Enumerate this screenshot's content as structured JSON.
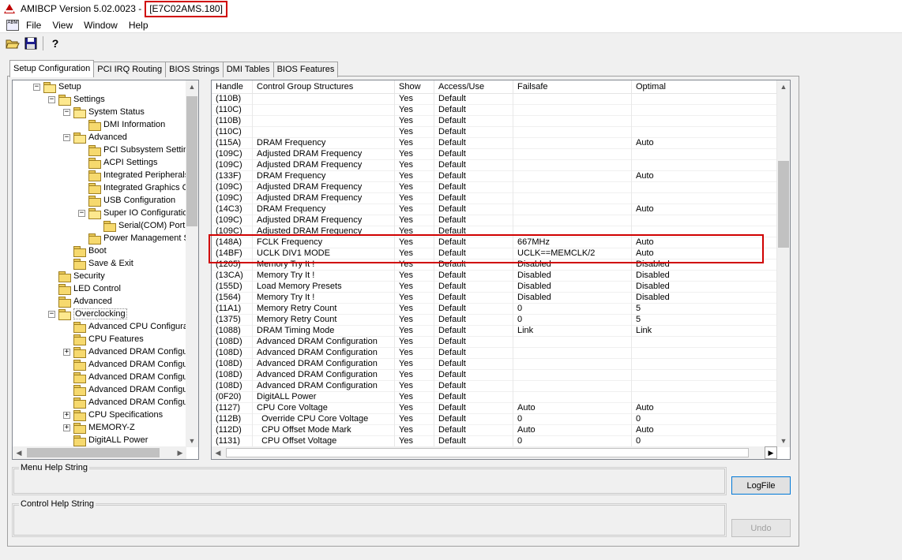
{
  "window": {
    "title_prefix": "AMIBCP Version 5.02.0023 -",
    "title_file": "[E7C02AMS.180]"
  },
  "menu": [
    "File",
    "View",
    "Window",
    "Help"
  ],
  "toolbar": {
    "system_icon_text": "ABM",
    "buttons": [
      "open-icon",
      "save-icon",
      "help-icon"
    ],
    "help_glyph": "?"
  },
  "tabs": [
    "Setup Configuration",
    "PCI IRQ Routing",
    "BIOS Strings",
    "DMI Tables",
    "BIOS Features"
  ],
  "tree": [
    {
      "label": "Setup",
      "level": 0,
      "exp": "-",
      "open": true
    },
    {
      "label": "Settings",
      "level": 1,
      "exp": "-",
      "open": true
    },
    {
      "label": "System Status",
      "level": 2,
      "exp": "-",
      "open": true
    },
    {
      "label": "DMI Information",
      "level": 3,
      "exp": ""
    },
    {
      "label": "Advanced",
      "level": 2,
      "exp": "-",
      "open": true
    },
    {
      "label": "PCI Subsystem Settings",
      "level": 3,
      "exp": ""
    },
    {
      "label": "ACPI Settings",
      "level": 3,
      "exp": ""
    },
    {
      "label": "Integrated Peripherals",
      "level": 3,
      "exp": ""
    },
    {
      "label": "Integrated Graphics Configuration",
      "level": 3,
      "exp": ""
    },
    {
      "label": "USB Configuration",
      "level": 3,
      "exp": ""
    },
    {
      "label": "Super IO Configuration",
      "level": 3,
      "exp": "-",
      "open": true
    },
    {
      "label": "Serial(COM) Port",
      "level": 4,
      "exp": ""
    },
    {
      "label": "Power Management Setup",
      "level": 3,
      "exp": ""
    },
    {
      "label": "Boot",
      "level": 2,
      "exp": ""
    },
    {
      "label": "Save & Exit",
      "level": 2,
      "exp": ""
    },
    {
      "label": "Security",
      "level": 1,
      "exp": ""
    },
    {
      "label": "LED Control",
      "level": 1,
      "exp": ""
    },
    {
      "label": "Advanced",
      "level": 1,
      "exp": ""
    },
    {
      "label": "Overclocking",
      "level": 1,
      "exp": "-",
      "open": true,
      "selected": true
    },
    {
      "label": "Advanced CPU Configuration",
      "level": 2,
      "exp": ""
    },
    {
      "label": "CPU Features",
      "level": 2,
      "exp": ""
    },
    {
      "label": "Advanced DRAM Configuration",
      "level": 2,
      "exp": "+"
    },
    {
      "label": "Advanced DRAM Configuration",
      "level": 2,
      "exp": ""
    },
    {
      "label": "Advanced DRAM Configuration",
      "level": 2,
      "exp": ""
    },
    {
      "label": "Advanced DRAM Configuration",
      "level": 2,
      "exp": ""
    },
    {
      "label": "Advanced DRAM Configuration",
      "level": 2,
      "exp": ""
    },
    {
      "label": "CPU Specifications",
      "level": 2,
      "exp": "+"
    },
    {
      "label": "MEMORY-Z",
      "level": 2,
      "exp": "+"
    },
    {
      "label": "DigitALL Power",
      "level": 2,
      "exp": ""
    }
  ],
  "grid": {
    "columns": [
      "Handle",
      "Control Group Structures",
      "Show",
      "Access/Use",
      "Failsafe",
      "Optimal"
    ],
    "rows": [
      [
        "(110B)",
        "",
        "Yes",
        "Default",
        "",
        ""
      ],
      [
        "(110C)",
        "",
        "Yes",
        "Default",
        "",
        ""
      ],
      [
        "(110B)",
        "",
        "Yes",
        "Default",
        "",
        ""
      ],
      [
        "(110C)",
        "",
        "Yes",
        "Default",
        "",
        ""
      ],
      [
        "(115A)",
        "DRAM Frequency",
        "Yes",
        "Default",
        "",
        "Auto"
      ],
      [
        "(109C)",
        "Adjusted DRAM Frequency",
        "Yes",
        "Default",
        "",
        ""
      ],
      [
        "(109C)",
        "Adjusted DRAM Frequency",
        "Yes",
        "Default",
        "",
        ""
      ],
      [
        "(133F)",
        "DRAM Frequency",
        "Yes",
        "Default",
        "",
        "Auto"
      ],
      [
        "(109C)",
        "Adjusted DRAM Frequency",
        "Yes",
        "Default",
        "",
        ""
      ],
      [
        "(109C)",
        "Adjusted DRAM Frequency",
        "Yes",
        "Default",
        "",
        ""
      ],
      [
        "(14C3)",
        "DRAM Frequency",
        "Yes",
        "Default",
        "",
        "Auto"
      ],
      [
        "(109C)",
        "Adjusted DRAM Frequency",
        "Yes",
        "Default",
        "",
        ""
      ],
      [
        "(109C)",
        "Adjusted DRAM Frequency",
        "Yes",
        "Default",
        "",
        ""
      ],
      [
        "(148A)",
        "FCLK Frequency",
        "Yes",
        "Default",
        "667MHz",
        "Auto"
      ],
      [
        "(14BF)",
        "UCLK DIV1 MODE",
        "Yes",
        "Default",
        "UCLK==MEMCLK/2",
        "Auto"
      ],
      [
        "(1205)",
        "Memory Try It !",
        "Yes",
        "Default",
        "Disabled",
        "Disabled"
      ],
      [
        "(13CA)",
        "Memory Try It !",
        "Yes",
        "Default",
        "Disabled",
        "Disabled"
      ],
      [
        "(155D)",
        "Load Memory Presets",
        "Yes",
        "Default",
        "Disabled",
        "Disabled"
      ],
      [
        "(1564)",
        "Memory Try It !",
        "Yes",
        "Default",
        "Disabled",
        "Disabled"
      ],
      [
        "(11A1)",
        "Memory Retry Count",
        "Yes",
        "Default",
        "0",
        "5"
      ],
      [
        "(1375)",
        "Memory Retry Count",
        "Yes",
        "Default",
        "0",
        "5"
      ],
      [
        "(1088)",
        "DRAM Timing Mode",
        "Yes",
        "Default",
        "Link",
        "Link"
      ],
      [
        "(108D)",
        "Advanced DRAM Configuration",
        "Yes",
        "Default",
        "",
        ""
      ],
      [
        "(108D)",
        "Advanced DRAM Configuration",
        "Yes",
        "Default",
        "",
        ""
      ],
      [
        "(108D)",
        "Advanced DRAM Configuration",
        "Yes",
        "Default",
        "",
        ""
      ],
      [
        "(108D)",
        "Advanced DRAM Configuration",
        "Yes",
        "Default",
        "",
        ""
      ],
      [
        "(108D)",
        "Advanced DRAM Configuration",
        "Yes",
        "Default",
        "",
        ""
      ],
      [
        "(0F20)",
        "DigitALL Power",
        "Yes",
        "Default",
        "",
        ""
      ],
      [
        "(1127)",
        "CPU Core Voltage",
        "Yes",
        "Default",
        "Auto",
        "Auto"
      ],
      [
        "(112B)",
        "  Override CPU Core Voltage",
        "Yes",
        "Default",
        "0",
        "0"
      ],
      [
        "(112D)",
        "  CPU Offset Mode Mark",
        "Yes",
        "Default",
        "Auto",
        "Auto"
      ],
      [
        "(1131)",
        "  CPU Offset Voltage",
        "Yes",
        "Default",
        "0",
        "0"
      ]
    ]
  },
  "help": {
    "menu_label": "Menu Help String",
    "control_label": "Control Help String"
  },
  "buttons": {
    "logfile": "LogFile",
    "undo": "Undo"
  },
  "colors": {
    "highlight": "#d00000",
    "folder": "#f6d96e"
  }
}
